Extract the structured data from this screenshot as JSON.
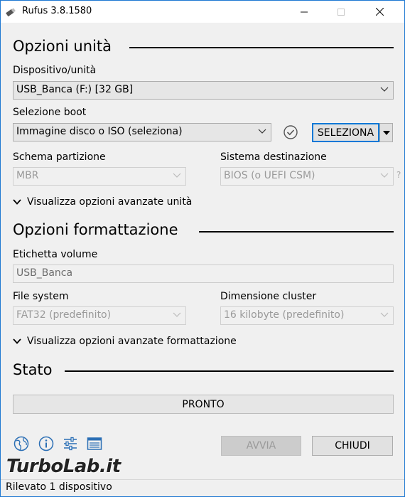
{
  "window": {
    "title": "Rufus 3.8.1580"
  },
  "drive_section": {
    "title": "Opzioni unità",
    "device_label": "Dispositivo/unità",
    "device_value": "USB_Banca (F:) [32 GB]",
    "boot_label": "Selezione boot",
    "boot_value": "Immagine disco o ISO (seleziona)",
    "select_button": "SELEZIONA",
    "partition_label": "Schema partizione",
    "partition_value": "MBR",
    "target_label": "Sistema destinazione",
    "target_value": "BIOS (o UEFI CSM)",
    "target_help": "?",
    "advanced_toggle": "Visualizza opzioni avanzate unità"
  },
  "format_section": {
    "title": "Opzioni formattazione",
    "volume_label": "Etichetta volume",
    "volume_value": "USB_Banca",
    "fs_label": "File system",
    "fs_value": "FAT32 (predefinito)",
    "cluster_label": "Dimensione cluster",
    "cluster_value": "16 kilobyte (predefinito)",
    "advanced_toggle": "Visualizza opzioni avanzate formattazione"
  },
  "status_section": {
    "title": "Stato",
    "progress_text": "PRONTO",
    "progress_fraction": 0
  },
  "footer": {
    "start_button": "AVVIA",
    "close_button": "CHIUDI",
    "status_text": "Rilevato 1 dispositivo",
    "watermark": "TurboLab.it"
  },
  "icons": [
    "globe-icon",
    "info-icon",
    "settings-sliders-icon",
    "log-icon"
  ]
}
